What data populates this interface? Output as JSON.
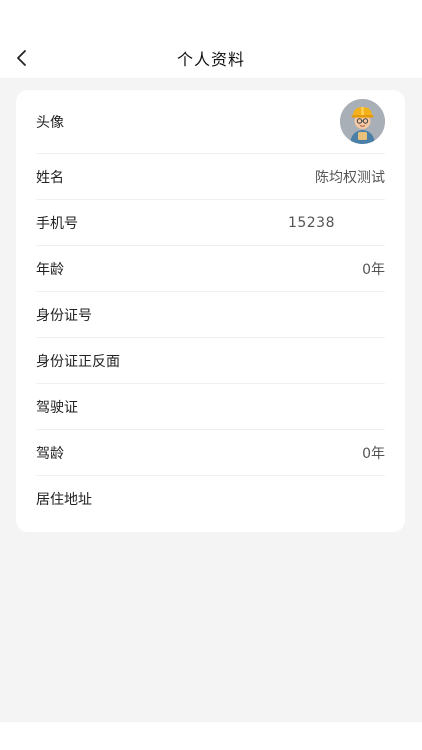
{
  "header": {
    "title": "个人资料"
  },
  "profile": {
    "avatar_label": "头像",
    "name_label": "姓名",
    "name_value": "陈均权测试",
    "phone_label": "手机号",
    "phone_value": "15238",
    "age_label": "年龄",
    "age_value": "0年",
    "id_number_label": "身份证号",
    "id_card_photos_label": "身份证正反面",
    "driver_license_label": "驾驶证",
    "driving_years_label": "驾龄",
    "driving_years_value": "0年",
    "address_label": "居住地址"
  }
}
